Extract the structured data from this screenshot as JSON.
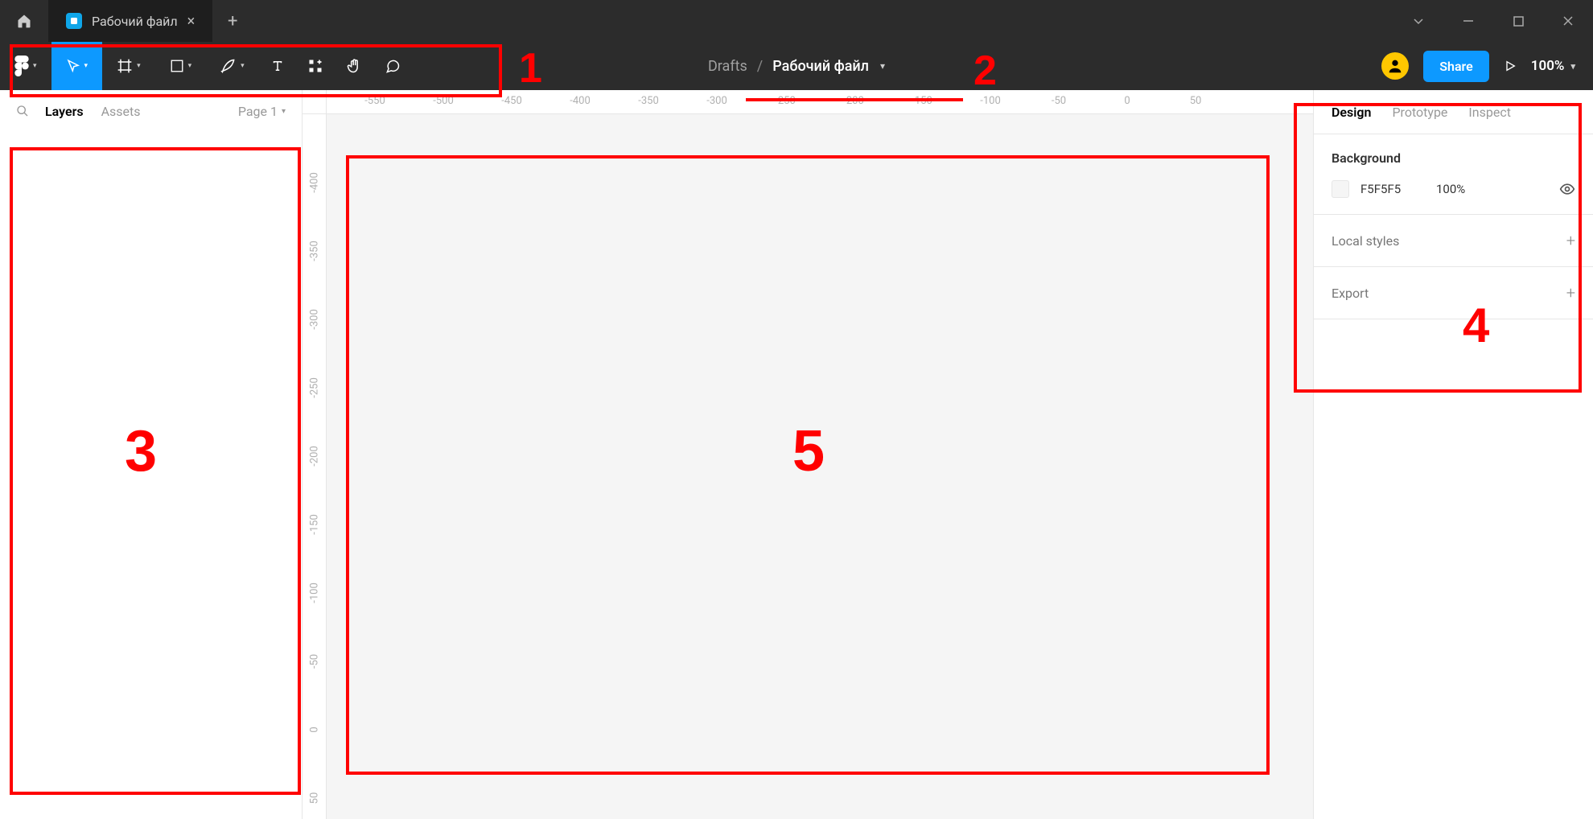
{
  "titlebar": {
    "tab_name": "Рабочий файл"
  },
  "toolbar": {
    "breadcrumb_root": "Drafts",
    "breadcrumb_file": "Рабочий файл",
    "share_label": "Share",
    "zoom": "100%"
  },
  "left_panel": {
    "tabs": {
      "layers": "Layers",
      "assets": "Assets"
    },
    "page_selector": "Page 1"
  },
  "ruler_h": [
    "-550",
    "-500",
    "-450",
    "-400",
    "-350",
    "-300",
    "-250",
    "-200",
    "-150",
    "-100",
    "-50",
    "0",
    "50"
  ],
  "ruler_v": [
    "-400",
    "-350",
    "-300",
    "-250",
    "-200",
    "-150",
    "-100",
    "-50",
    "0",
    "50"
  ],
  "right_panel": {
    "tabs": {
      "design": "Design",
      "prototype": "Prototype",
      "inspect": "Inspect"
    },
    "background": {
      "title": "Background",
      "hex": "F5F5F5",
      "opacity": "100%"
    },
    "local_styles": "Local styles",
    "export": "Export"
  },
  "annotations": {
    "n1": "1",
    "n2": "2",
    "n3": "3",
    "n4": "4",
    "n5": "5"
  }
}
